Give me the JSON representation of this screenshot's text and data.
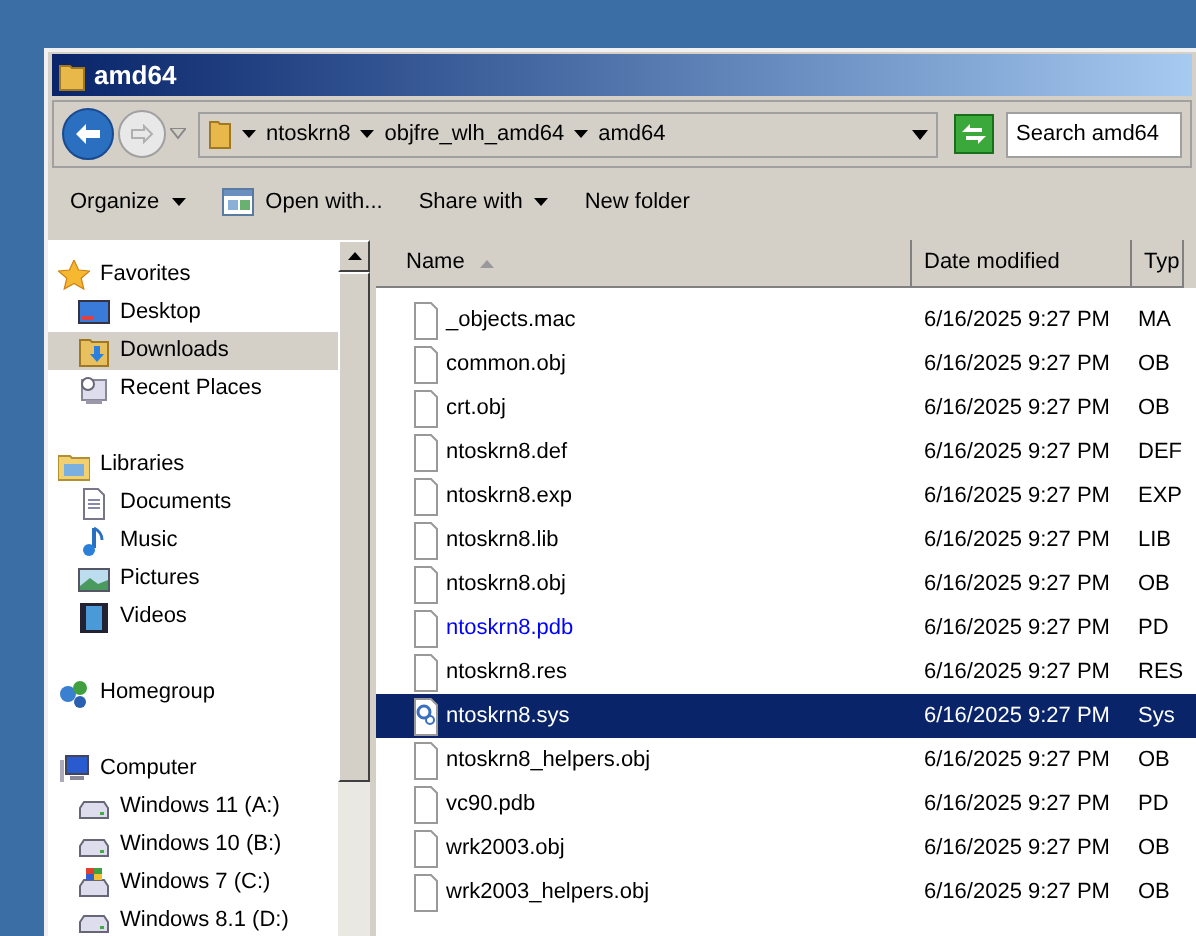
{
  "window": {
    "title": "amd64"
  },
  "address_bar": {
    "crumbs": [
      "ntoskrn8",
      "objfre_wlh_amd64",
      "amd64"
    ]
  },
  "search": {
    "placeholder": "Search amd64"
  },
  "toolbar": [
    {
      "label": "Organize",
      "dropdown": true,
      "kind": "menu"
    },
    {
      "label": "Open with...",
      "dropdown": false,
      "kind": "open"
    },
    {
      "label": "Share with",
      "dropdown": true,
      "kind": "menu"
    },
    {
      "label": "New folder",
      "dropdown": false,
      "kind": "menu"
    }
  ],
  "sidebar": {
    "groups": [
      {
        "label": "Favorites",
        "kind": "star",
        "children": [
          {
            "label": "Desktop",
            "kind": "desktop",
            "selected": false
          },
          {
            "label": "Downloads",
            "kind": "downloads",
            "selected": true
          },
          {
            "label": "Recent Places",
            "kind": "recent",
            "selected": false
          }
        ]
      },
      {
        "label": "Libraries",
        "kind": "library",
        "children": [
          {
            "label": "Documents",
            "kind": "document",
            "selected": false
          },
          {
            "label": "Music",
            "kind": "music",
            "selected": false
          },
          {
            "label": "Pictures",
            "kind": "pictures",
            "selected": false
          },
          {
            "label": "Videos",
            "kind": "videos",
            "selected": false
          }
        ]
      },
      {
        "label": "Homegroup",
        "kind": "homegroup"
      },
      {
        "label": "Computer",
        "kind": "computer",
        "children": [
          {
            "label": "Windows 11 (A:)",
            "kind": "drive",
            "selected": false
          },
          {
            "label": "Windows 10 (B:)",
            "kind": "drive",
            "selected": false
          },
          {
            "label": "Windows 7 (C:)",
            "kind": "windrive",
            "selected": false
          },
          {
            "label": "Windows 8.1 (D:)",
            "kind": "drive",
            "selected": false
          }
        ]
      }
    ]
  },
  "table": {
    "columns": [
      "Name",
      "Date modified",
      "Typ"
    ],
    "rows": [
      {
        "name": "_objects.mac",
        "date": "6/16/2025 9:27 PM",
        "type": "MA",
        "kind": "file",
        "compressed": false,
        "selected": false
      },
      {
        "name": "common.obj",
        "date": "6/16/2025 9:27 PM",
        "type": "OB",
        "kind": "file",
        "compressed": false,
        "selected": false
      },
      {
        "name": "crt.obj",
        "date": "6/16/2025 9:27 PM",
        "type": "OB",
        "kind": "file",
        "compressed": false,
        "selected": false
      },
      {
        "name": "ntoskrn8.def",
        "date": "6/16/2025 9:27 PM",
        "type": "DEF",
        "kind": "file",
        "compressed": false,
        "selected": false
      },
      {
        "name": "ntoskrn8.exp",
        "date": "6/16/2025 9:27 PM",
        "type": "EXP",
        "kind": "file",
        "compressed": false,
        "selected": false
      },
      {
        "name": "ntoskrn8.lib",
        "date": "6/16/2025 9:27 PM",
        "type": "LIB",
        "kind": "file",
        "compressed": false,
        "selected": false
      },
      {
        "name": "ntoskrn8.obj",
        "date": "6/16/2025 9:27 PM",
        "type": "OB",
        "kind": "file",
        "compressed": false,
        "selected": false
      },
      {
        "name": "ntoskrn8.pdb",
        "date": "6/16/2025 9:27 PM",
        "type": "PD",
        "kind": "file",
        "compressed": true,
        "selected": false
      },
      {
        "name": "ntoskrn8.res",
        "date": "6/16/2025 9:27 PM",
        "type": "RES",
        "kind": "file",
        "compressed": false,
        "selected": false
      },
      {
        "name": "ntoskrn8.sys",
        "date": "6/16/2025 9:27 PM",
        "type": "Sys",
        "kind": "driver",
        "compressed": false,
        "selected": true
      },
      {
        "name": "ntoskrn8_helpers.obj",
        "date": "6/16/2025 9:27 PM",
        "type": "OB",
        "kind": "file",
        "compressed": false,
        "selected": false
      },
      {
        "name": "vc90.pdb",
        "date": "6/16/2025 9:27 PM",
        "type": "PD",
        "kind": "file",
        "compressed": false,
        "selected": false
      },
      {
        "name": "wrk2003.obj",
        "date": "6/16/2025 9:27 PM",
        "type": "OB",
        "kind": "file",
        "compressed": false,
        "selected": false
      },
      {
        "name": "wrk2003_helpers.obj",
        "date": "6/16/2025 9:27 PM",
        "type": "OB",
        "kind": "file",
        "compressed": false,
        "selected": false
      }
    ]
  }
}
